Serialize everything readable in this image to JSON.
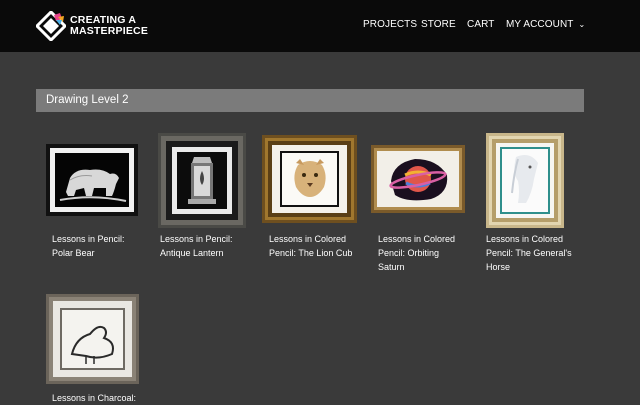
{
  "brand": {
    "line1": "CREATING A",
    "line2": "MASTERPIECE"
  },
  "nav": {
    "projects": "PROJECTS",
    "store": "STORE",
    "cart": "CART",
    "account": "MY ACCOUNT"
  },
  "section": {
    "title": "Drawing Level 2"
  },
  "cards": [
    {
      "line1": "Lessons in Pencil:",
      "line2": "Polar Bear",
      "line3": ""
    },
    {
      "line1": "Lessons in Pencil:",
      "line2": "Antique Lantern",
      "line3": ""
    },
    {
      "line1": "Lessons in Colored",
      "line2": "Pencil: The Lion Cub",
      "line3": ""
    },
    {
      "line1": "Lessons in Colored",
      "line2": "Pencil: Orbiting",
      "line3": "Saturn"
    },
    {
      "line1": "Lessons in Colored",
      "line2": "Pencil: The General's",
      "line3": "Horse"
    },
    {
      "line1": "Lessons in Charcoal:",
      "line2": "",
      "line3": ""
    }
  ]
}
